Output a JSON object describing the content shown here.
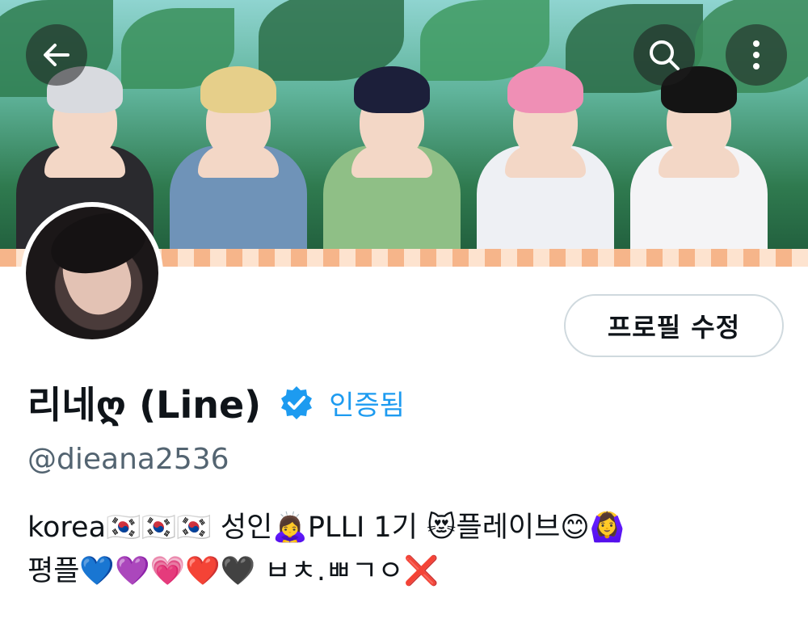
{
  "header": {
    "back_icon": "arrow-left-icon",
    "search_icon": "search-icon",
    "more_icon": "more-vertical-icon"
  },
  "profile": {
    "display_name": "리네ღ (Line)",
    "verified_label": "인증됨",
    "handle": "@dieana2536",
    "edit_button_label": "프로필 수정",
    "bio_line1": "korea🇰🇷🇰🇷🇰🇷 성인🙇‍♀️PLLI 1기 😻플레이브😊🙆‍♀️",
    "bio_line2": "평플💙💜💗❤️🖤 ㅂㅊ.ㅃㄱㅇ❌"
  },
  "colors": {
    "accent": "#1d9bf0",
    "text_primary": "#0f1419",
    "text_secondary": "#536471",
    "border": "#cfd9de"
  }
}
